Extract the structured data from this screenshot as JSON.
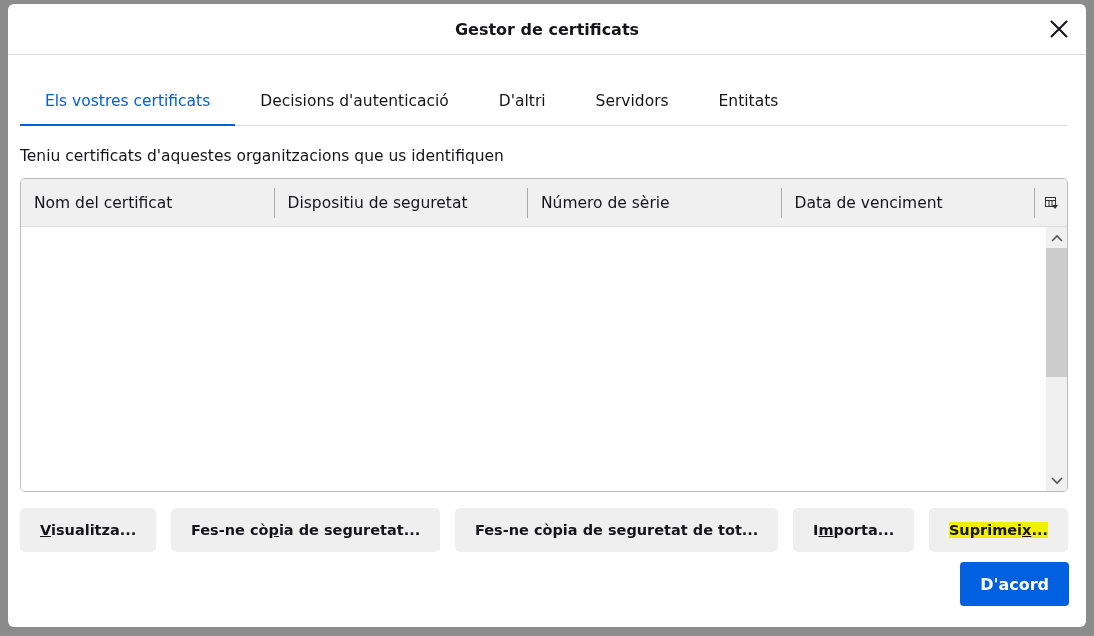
{
  "window": {
    "title": "Gestor de certificats"
  },
  "tabs": [
    {
      "label": "Els vostres certificats",
      "selected": true
    },
    {
      "label": "Decisions d'autenticació",
      "selected": false
    },
    {
      "label": "D'altri",
      "selected": false
    },
    {
      "label": "Servidors",
      "selected": false
    },
    {
      "label": "Entitats",
      "selected": false
    }
  ],
  "description": "Teniu certificats d'aquestes organitzacions que us identifiquen",
  "table": {
    "columns": [
      "Nom del certificat",
      "Dispositiu de seguretat",
      "Número de sèrie",
      "Data de venciment"
    ]
  },
  "buttons": [
    {
      "key": "V",
      "after": "isualitza...",
      "highlighted": false
    },
    {
      "before": "Fes-ne cò",
      "key": "p",
      "after": "ia de seguretat...",
      "highlighted": false
    },
    {
      "before": "Fes-ne còpia de seguretat de tot...",
      "highlighted": false
    },
    {
      "before": "I",
      "key": "m",
      "after": "porta...",
      "highlighted": false
    },
    {
      "before": "Suprimei",
      "key": "x",
      "after": "...",
      "highlighted": true
    }
  ],
  "ok_button": "D'acord"
}
